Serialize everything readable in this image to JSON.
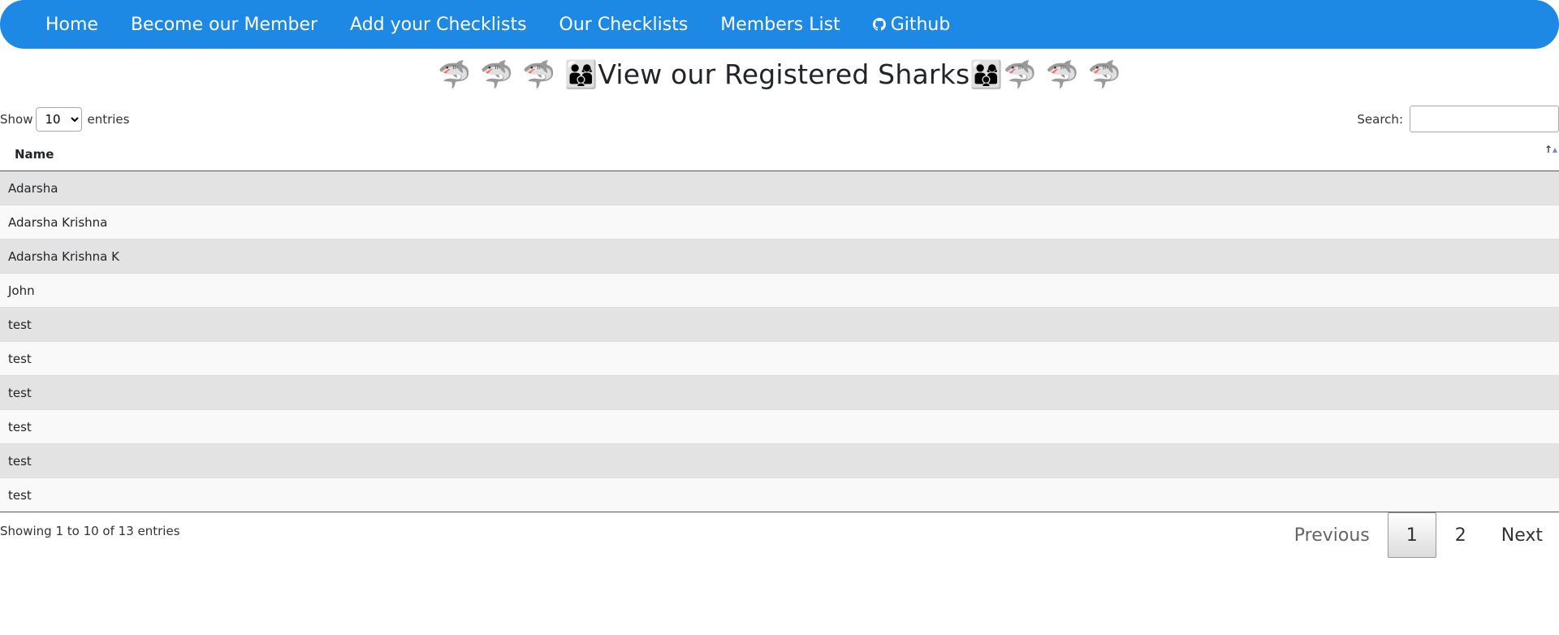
{
  "nav": {
    "items": [
      {
        "label": "Home"
      },
      {
        "label": "Become our Member"
      },
      {
        "label": "Add your Checklists"
      },
      {
        "label": "Our Checklists"
      },
      {
        "label": "Members List"
      },
      {
        "label": "Github",
        "icon": "github-icon"
      }
    ],
    "background": "#1e88e5"
  },
  "page": {
    "title": "🦈 🦈 🦈 👨‍👩‍👦View our Registered Sharks👨‍👩‍👦🦈 🦈 🦈"
  },
  "table_controls": {
    "show_label": "Show",
    "entries_label": "entries",
    "length_value": "10",
    "search_label": "Search:",
    "search_placeholder": ""
  },
  "table": {
    "columns": [
      "Name"
    ],
    "sort": "ascending",
    "rows": [
      [
        "Adarsha"
      ],
      [
        "Adarsha Krishna"
      ],
      [
        "Adarsha Krishna K"
      ],
      [
        "John"
      ],
      [
        "test"
      ],
      [
        "test"
      ],
      [
        "test"
      ],
      [
        "test"
      ],
      [
        "test"
      ],
      [
        "test"
      ]
    ]
  },
  "info": "Showing 1 to 10 of 13 entries",
  "pagination": {
    "previous": "Previous",
    "pages": [
      "1",
      "2"
    ],
    "current": "1",
    "next": "Next"
  }
}
